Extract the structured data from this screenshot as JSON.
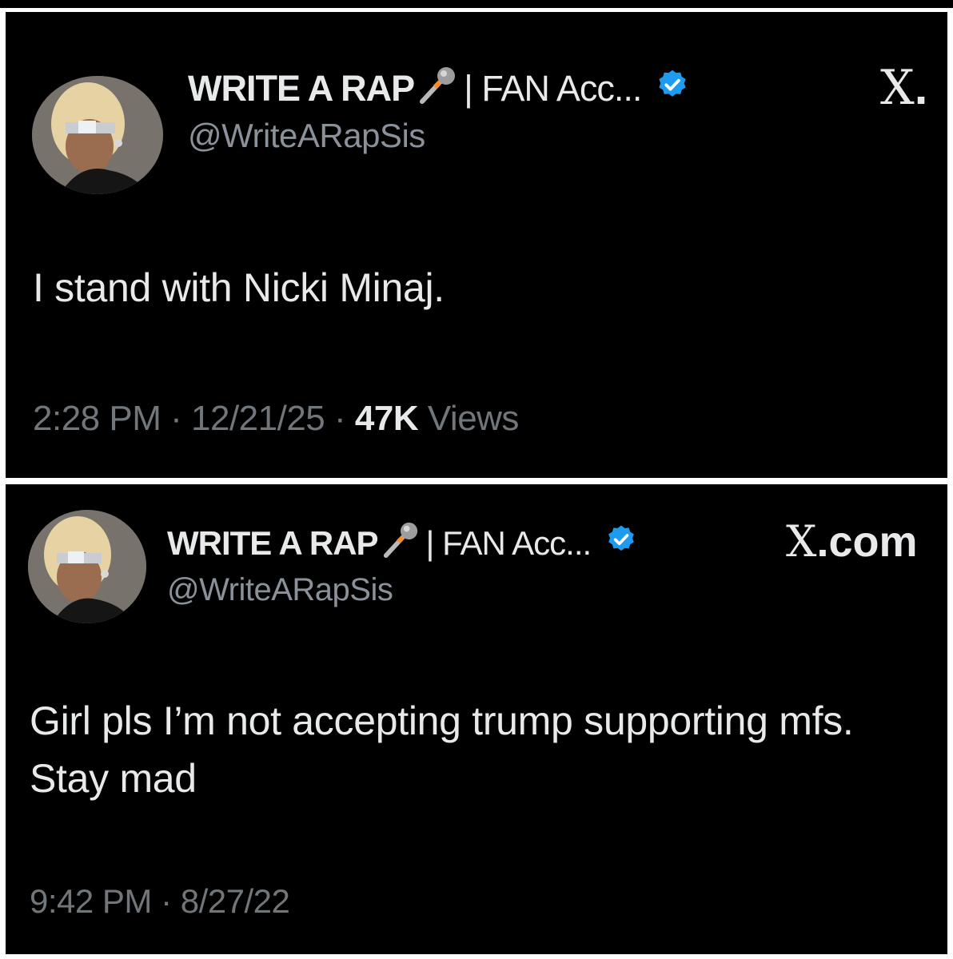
{
  "tweets": [
    {
      "display_name": "WRITE A RAP",
      "name_suffix": "| FAN Acc...",
      "handle": "@WriteARapSis",
      "source_logo": "X",
      "source_suffix": ".",
      "text": "I stand with Nicki Minaj.",
      "time": "2:28 PM",
      "date": "12/21/25",
      "views_count": "47K",
      "views_label": "Views"
    },
    {
      "display_name": "WRITE A RAP",
      "name_suffix": "| FAN Acc...",
      "handle": "@WriteARapSis",
      "source_logo": "X",
      "source_suffix": ".com",
      "text": "Girl pls I’m not accepting trump supporting mfs. Stay mad",
      "time": "9:42 PM",
      "date": "8/27/22"
    }
  ],
  "meta_separator": "·",
  "icons": [
    "avatar",
    "microphone-icon",
    "verified-badge-icon",
    "x-logo-icon"
  ],
  "colors": {
    "background": "#000000",
    "text_primary": "#e7e9ea",
    "text_secondary": "#71767b",
    "verified_blue": "#1d9bf0"
  }
}
